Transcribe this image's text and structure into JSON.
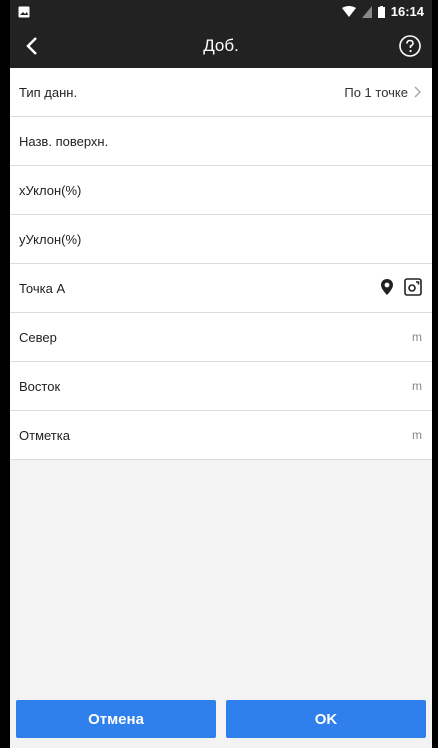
{
  "status": {
    "time": "16:14"
  },
  "header": {
    "title": "Доб."
  },
  "rows": {
    "data_type_label": "Тип данн.",
    "data_type_value": "По 1 точке",
    "surface_name_label": "Назв. поверхн.",
    "x_slope_label": "хУклон(%)",
    "y_slope_label": "уУклон(%)"
  },
  "point_a": {
    "label": "Точка А",
    "fields": [
      {
        "label": "Север",
        "unit": "m"
      },
      {
        "label": "Восток",
        "unit": "m"
      },
      {
        "label": "Отметка",
        "unit": "m"
      }
    ]
  },
  "buttons": {
    "cancel": "Отмена",
    "ok": "OK"
  },
  "colors": {
    "accent": "#2f80ed",
    "header_bg": "#222222",
    "pin_icon": "#222222"
  },
  "icons": {
    "back": "back-arrow-icon",
    "help": "help-icon",
    "chevron": "chevron-right-icon",
    "pin": "location-pin-icon",
    "survey": "survey-point-icon",
    "wifi": "wifi-icon",
    "battery": "battery-icon",
    "gallery": "image-icon"
  }
}
